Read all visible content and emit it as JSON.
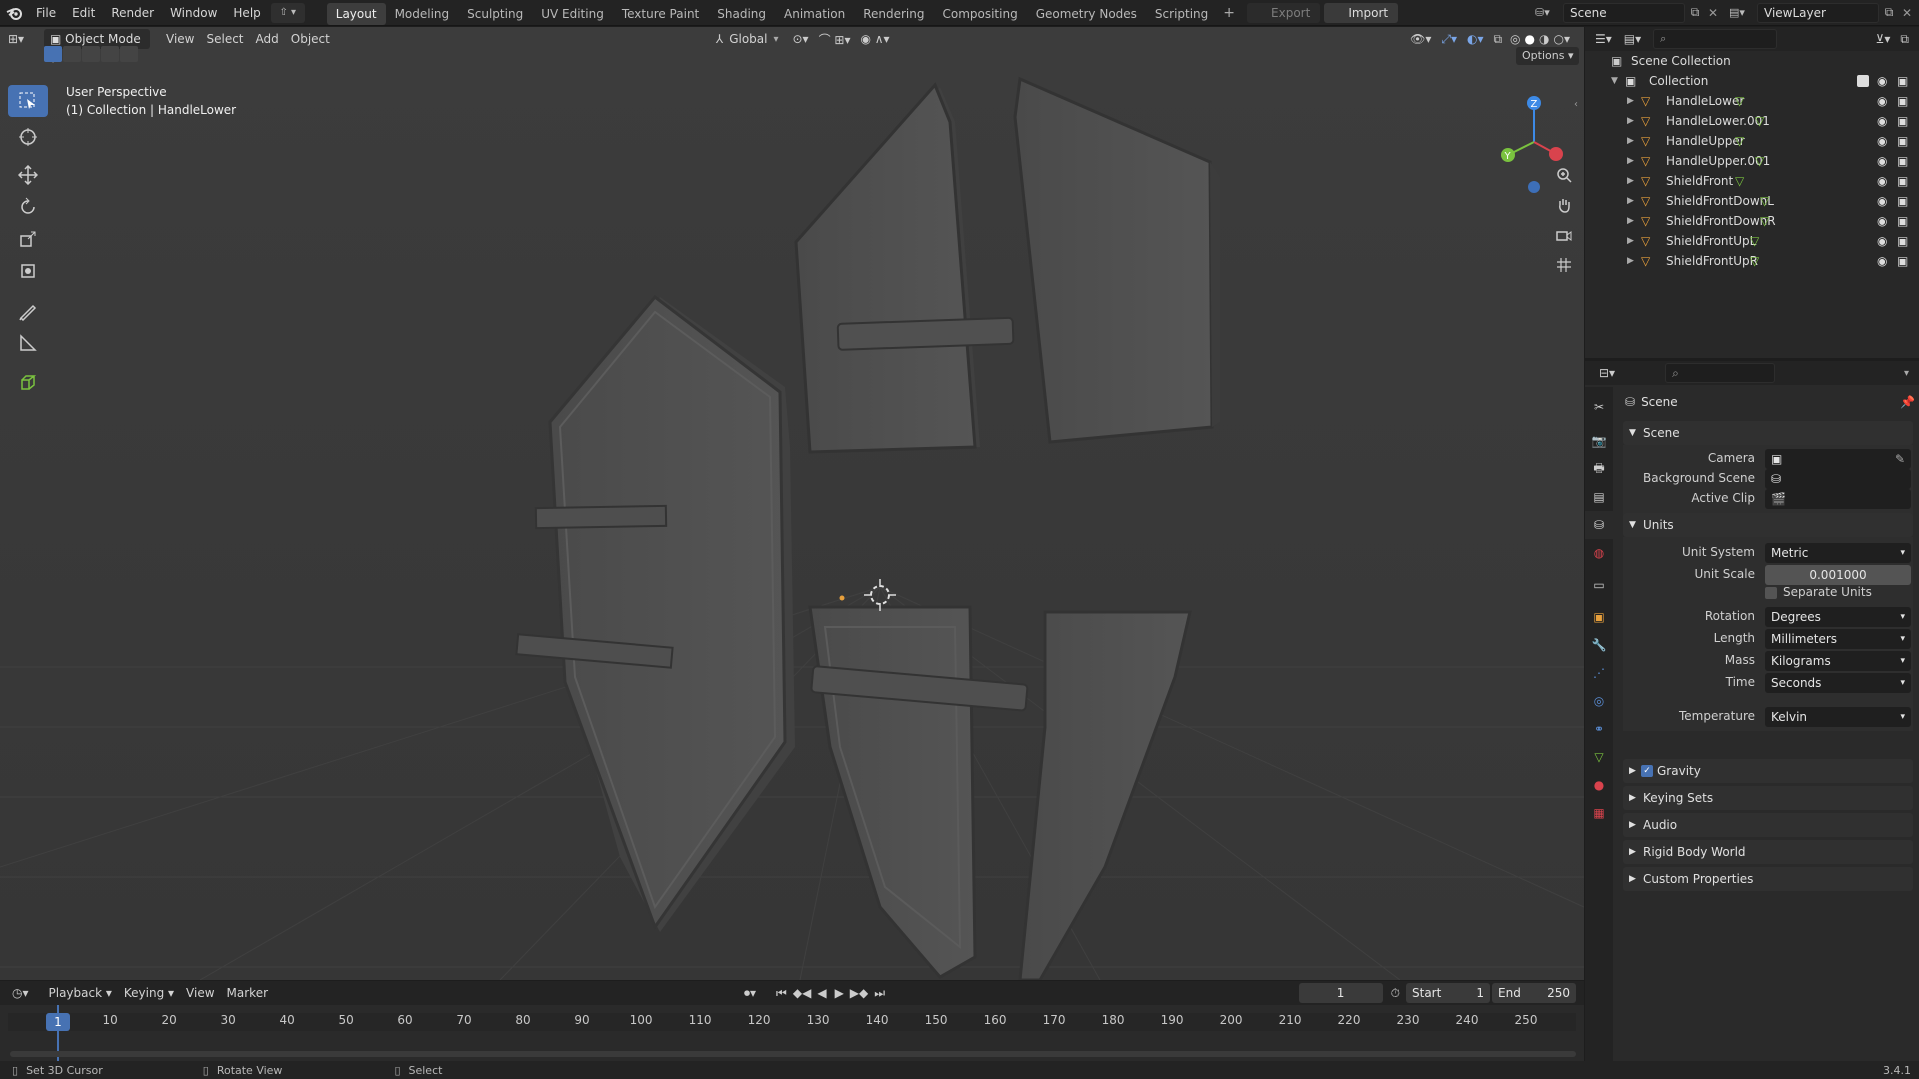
{
  "topbar": {
    "menus": [
      "File",
      "Edit",
      "Render",
      "Window",
      "Help"
    ],
    "workspaces": [
      "Layout",
      "Modeling",
      "Sculpting",
      "UV Editing",
      "Texture Paint",
      "Shading",
      "Animation",
      "Rendering",
      "Compositing",
      "Geometry Nodes",
      "Scripting"
    ],
    "active_workspace": "Layout",
    "export_label": "Export",
    "import_label": "Import",
    "scene_name": "Scene",
    "view_layer": "ViewLayer"
  },
  "viewport": {
    "mode": "Object Mode",
    "menus": [
      "View",
      "Select",
      "Add",
      "Object"
    ],
    "orientation": "Global",
    "options_label": "Options",
    "overlay_title": "User Perspective",
    "overlay_sub": "(1) Collection | HandleLower",
    "gizmo": {
      "z": "Z",
      "y": "Y"
    }
  },
  "outliner": {
    "scene_collection": "Scene Collection",
    "collection": "Collection",
    "objects": [
      "HandleLower",
      "HandleLower.001",
      "HandleUpper",
      "HandleUpper.001",
      "ShieldFront",
      "ShieldFrontDownL",
      "ShieldFrontDownR",
      "ShieldFrontUpL",
      "ShieldFrontUpR"
    ]
  },
  "properties": {
    "context": "Scene",
    "scene_panel": "Scene",
    "camera_label": "Camera",
    "bg_scene_label": "Background Scene",
    "active_clip_label": "Active Clip",
    "units_panel": "Units",
    "unit_system_label": "Unit System",
    "unit_system": "Metric",
    "unit_scale_label": "Unit Scale",
    "unit_scale": "0.001000",
    "separate_units": "Separate Units",
    "rotation_label": "Rotation",
    "rotation": "Degrees",
    "length_label": "Length",
    "length": "Millimeters",
    "mass_label": "Mass",
    "mass": "Kilograms",
    "time_label": "Time",
    "time": "Seconds",
    "temperature_label": "Temperature",
    "temperature": "Kelvin",
    "panels": [
      "Gravity",
      "Keying Sets",
      "Audio",
      "Rigid Body World",
      "Custom Properties"
    ]
  },
  "timeline": {
    "menus": [
      "Playback",
      "Keying",
      "View",
      "Marker"
    ],
    "current_frame": "1",
    "start_label": "Start",
    "start": "1",
    "end_label": "End",
    "end": "250",
    "ticks": [
      "1",
      "10",
      "20",
      "30",
      "40",
      "50",
      "60",
      "70",
      "80",
      "90",
      "100",
      "110",
      "120",
      "130",
      "140",
      "150",
      "160",
      "170",
      "180",
      "190",
      "200",
      "210",
      "220",
      "230",
      "240",
      "250"
    ]
  },
  "statusbar": {
    "left": "Set 3D Cursor",
    "middle": "Rotate View",
    "right": "Select",
    "version": "3.4.1"
  },
  "colors": {
    "accent": "#4772b3",
    "selected_orange": "#e8a03c",
    "gizmo_x": "#d9434d",
    "gizmo_y": "#7ac23f",
    "gizmo_z": "#3d8ae6"
  }
}
